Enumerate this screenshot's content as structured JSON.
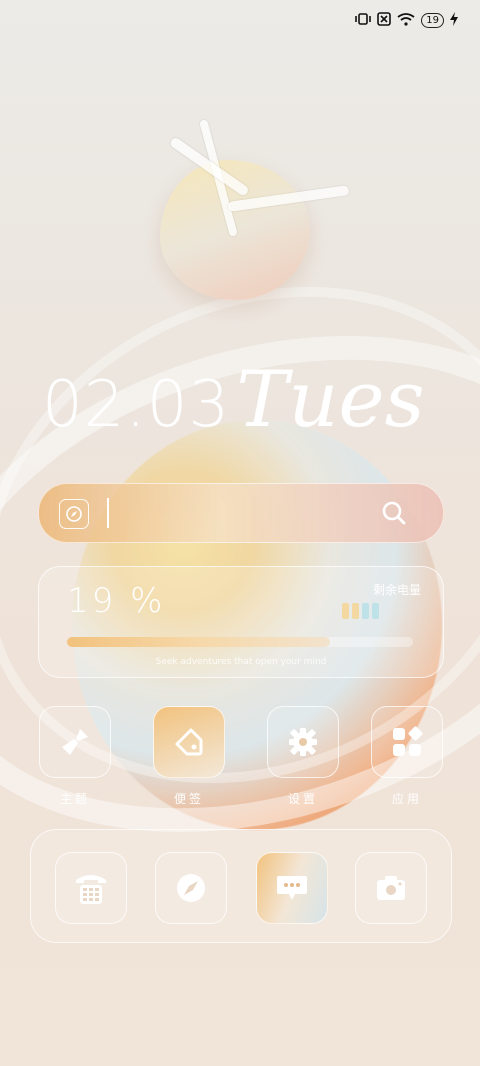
{
  "status_bar": {
    "battery_level": "19",
    "icons": [
      "vibrate-icon",
      "no-sim-icon",
      "wifi-icon",
      "battery-icon",
      "charging-icon"
    ]
  },
  "clock": {
    "hour_hand_deg": -35,
    "minute_hand_deg": -15
  },
  "date_widget": {
    "date": "02.03",
    "weekday": "Tues"
  },
  "search_bar": {
    "left_icon": "compass-icon",
    "right_icon": "search-icon"
  },
  "battery_widget": {
    "percent": "19 %",
    "label": "剩余电量",
    "fill_fraction": 0.76,
    "slogan": "Seek adventures that open your mind",
    "bar_colors": [
      "#f3d9a1",
      "#f3d9a1",
      "#bfe1e8",
      "#bfe1e8"
    ]
  },
  "apps": [
    {
      "label": "主题",
      "icon": "brush-icon"
    },
    {
      "label": "便签",
      "icon": "tag-icon"
    },
    {
      "label": "设置",
      "icon": "gear-icon"
    },
    {
      "label": "应用",
      "icon": "apps-grid-icon"
    }
  ],
  "dock": [
    {
      "icon": "phone-icon"
    },
    {
      "icon": "compass-icon"
    },
    {
      "icon": "message-icon"
    },
    {
      "icon": "camera-icon"
    }
  ],
  "colors": {
    "accent_orange": "#ea7a32",
    "accent_yellow": "#f2c27e",
    "text": "#ffffff"
  }
}
